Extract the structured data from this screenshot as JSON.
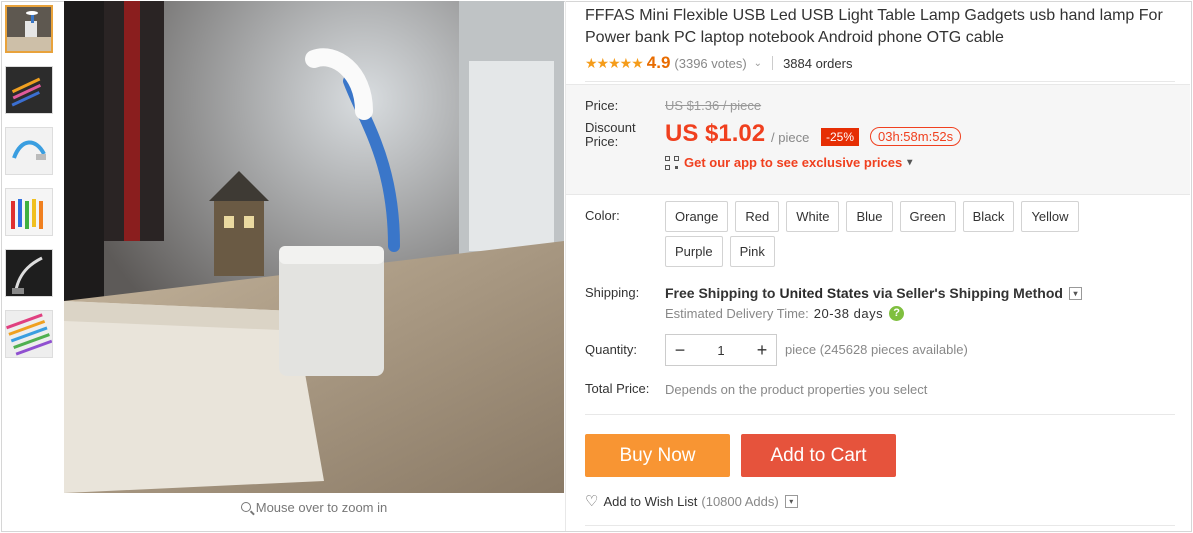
{
  "thumbnails": [
    {
      "name": "thumb-1",
      "active": true
    },
    {
      "name": "thumb-2",
      "active": false
    },
    {
      "name": "thumb-3",
      "active": false
    },
    {
      "name": "thumb-4",
      "active": false
    },
    {
      "name": "thumb-5",
      "active": false
    },
    {
      "name": "thumb-6",
      "active": false
    }
  ],
  "zoom_hint": "Mouse over to zoom in",
  "product": {
    "title": "FFFAS Mini Flexible USB Led USB Light Table Lamp Gadgets usb hand lamp For Power bank PC laptop notebook Android phone OTG cable",
    "stars": "★★★★★",
    "rating": "4.9",
    "votes": "(3396 votes)",
    "orders": "3884 orders"
  },
  "price": {
    "price_label": "Price:",
    "old_price": "US $1.36 / piece",
    "discount_label_1": "Discount",
    "discount_label_2": "Price:",
    "new_price": "US $1.02",
    "unit": "/ piece",
    "discount_badge": "-25%",
    "timer": "03h:58m:52s",
    "app_promo": "Get our app to see exclusive prices",
    "app_promo_chevron": "▾"
  },
  "color": {
    "label": "Color:",
    "options": [
      "Orange",
      "Red",
      "White",
      "Blue",
      "Green",
      "Black",
      "Yellow",
      "Purple",
      "Pink"
    ]
  },
  "shipping": {
    "label": "Shipping:",
    "free": "Free Shipping to",
    "country": "United States",
    "method": "via Seller's Shipping Method",
    "est_label": "Estimated Delivery Time:",
    "est_days": "20-38 days",
    "help": "?"
  },
  "quantity": {
    "label": "Quantity:",
    "minus": "−",
    "value": "1",
    "plus": "+",
    "available": "piece (245628 pieces available)"
  },
  "total": {
    "label": "Total Price:",
    "text": "Depends on the product properties you select"
  },
  "actions": {
    "buy_now": "Buy Now",
    "add_to_cart": "Add to Cart",
    "wish_label": "Add to Wish List",
    "wish_adds": "(10800 Adds)"
  },
  "colors_theme": {
    "price_red": "#f0401f",
    "buy_orange": "#f89533",
    "cart_red": "#e6533c",
    "star_orange": "#f59c1a"
  }
}
